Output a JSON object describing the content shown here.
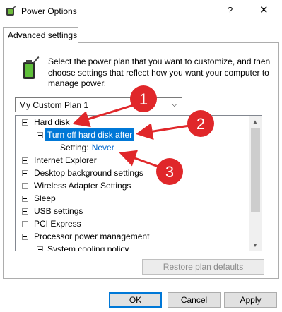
{
  "window": {
    "title": "Power Options",
    "help_glyph": "?",
    "close_glyph": "✕",
    "icon": "power-options-icon"
  },
  "tab": {
    "label": "Advanced settings"
  },
  "description": "Select the power plan that you want to customize, and then choose settings that reflect how you want your computer to manage power.",
  "plan_dropdown": {
    "selected": "My Custom Plan 1"
  },
  "tree": {
    "items": [
      {
        "label": "Hard disk",
        "expanded": true,
        "level": 0
      },
      {
        "label": "Turn off hard disk after",
        "expanded": true,
        "level": 1,
        "selected": true
      },
      {
        "label": "Setting:",
        "value": "Never",
        "level": 2
      },
      {
        "label": "Internet Explorer",
        "expanded": false,
        "level": 0
      },
      {
        "label": "Desktop background settings",
        "expanded": false,
        "level": 0
      },
      {
        "label": "Wireless Adapter Settings",
        "expanded": false,
        "level": 0
      },
      {
        "label": "Sleep",
        "expanded": false,
        "level": 0
      },
      {
        "label": "USB settings",
        "expanded": false,
        "level": 0
      },
      {
        "label": "PCI Express",
        "expanded": false,
        "level": 0
      },
      {
        "label": "Processor power management",
        "expanded": true,
        "level": 0
      },
      {
        "label": "System cooling policy",
        "expanded": true,
        "level": 1
      }
    ]
  },
  "buttons": {
    "restore": "Restore plan defaults",
    "ok": "OK",
    "cancel": "Cancel",
    "apply": "Apply"
  },
  "callouts": [
    "1",
    "2",
    "3"
  ],
  "colors": {
    "selection": "#0078d7",
    "setting_value": "#0066cc",
    "callout_red": "#e0272a"
  }
}
